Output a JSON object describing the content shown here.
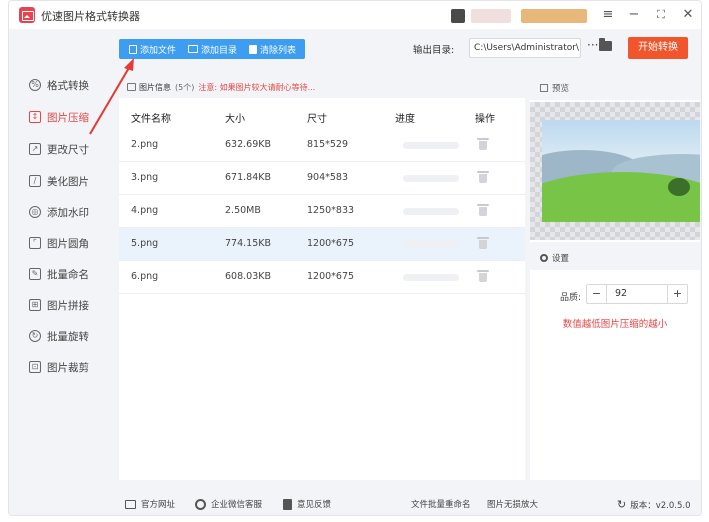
{
  "app": {
    "title": "优速图片格式转换器"
  },
  "sidebar": {
    "items": [
      {
        "label": "格式转换",
        "icon": "format-icon",
        "active": false
      },
      {
        "label": "图片压缩",
        "icon": "compress-icon",
        "active": true
      },
      {
        "label": "更改尺寸",
        "icon": "resize-icon",
        "active": false
      },
      {
        "label": "美化图片",
        "icon": "beautify-icon",
        "active": false
      },
      {
        "label": "添加水印",
        "icon": "watermark-icon",
        "active": false
      },
      {
        "label": "图片圆角",
        "icon": "round-corner-icon",
        "active": false
      },
      {
        "label": "批量命名",
        "icon": "rename-icon",
        "active": false
      },
      {
        "label": "图片拼接",
        "icon": "stitch-icon",
        "active": false
      },
      {
        "label": "批量旋转",
        "icon": "rotate-icon",
        "active": false
      },
      {
        "label": "图片裁剪",
        "icon": "crop-icon",
        "active": false
      }
    ]
  },
  "toolbar": {
    "add_file": "添加文件",
    "add_folder": "添加目录",
    "clear_list": "清除列表",
    "output_label": "输出目录:",
    "output_path": "C:\\Users\\Administrator\\",
    "browse": "···",
    "start": "开始转换"
  },
  "file_list": {
    "info_label": "图片信息",
    "count": "(5个)",
    "warning": "注意: 如果图片较大请耐心等待...",
    "headers": {
      "name": "文件名称",
      "size": "大小",
      "dimensions": "尺寸",
      "progress": "进度",
      "action": "操作"
    },
    "rows": [
      {
        "name": "2.png",
        "size": "632.69KB",
        "dimensions": "815*529",
        "progress": 0
      },
      {
        "name": "3.png",
        "size": "671.84KB",
        "dimensions": "904*583",
        "progress": 0
      },
      {
        "name": "4.png",
        "size": "2.50MB",
        "dimensions": "1250*833",
        "progress": 0
      },
      {
        "name": "5.png",
        "size": "774.15KB",
        "dimensions": "1200*675",
        "progress": 0
      },
      {
        "name": "6.png",
        "size": "608.03KB",
        "dimensions": "1200*675",
        "progress": 0
      }
    ]
  },
  "preview": {
    "label": "预览"
  },
  "settings": {
    "label": "设置",
    "quality_label": "品质:",
    "quality_value": "92",
    "minus": "−",
    "plus": "+",
    "hint": "数值越低图片压缩的越小"
  },
  "statusbar": {
    "website": "官方网址",
    "wechat": "企业微信客服",
    "feedback": "意见反馈",
    "batch_rename": "文件批量重命名",
    "lossless_enlarge": "图片无损放大",
    "version": "版本：v2.0.5.0"
  },
  "colors": {
    "accent_blue": "#3d9df0",
    "start_orange": "#f0552b",
    "active_red": "#e54646"
  }
}
